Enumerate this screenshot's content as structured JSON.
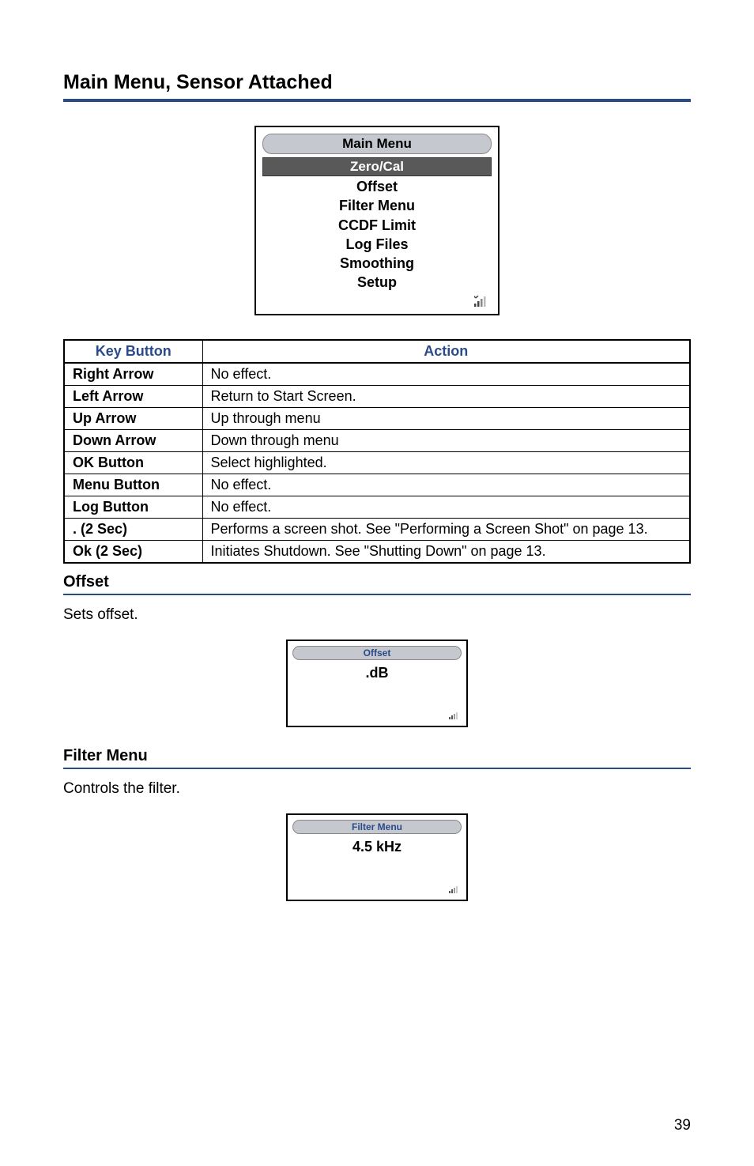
{
  "page": {
    "title": "Main Menu, Sensor Attached",
    "number": "39"
  },
  "main_menu_screenshot": {
    "title": "Main Menu",
    "highlighted": "Zero/Cal",
    "items": [
      "Offset",
      "Filter Menu",
      "CCDF Limit",
      "Log Files",
      "Smoothing",
      "Setup"
    ]
  },
  "table": {
    "headers": {
      "key": "Key Button",
      "action": "Action"
    },
    "rows": [
      {
        "key": "Right Arrow",
        "action": "No effect."
      },
      {
        "key": "Left Arrow",
        "action": "Return to Start Screen."
      },
      {
        "key": "Up Arrow",
        "action": "Up through menu"
      },
      {
        "key": "Down Arrow",
        "action": "Down through menu"
      },
      {
        "key": "OK Button",
        "action": "Select highlighted."
      },
      {
        "key": "Menu Button",
        "action": "No effect."
      },
      {
        "key": "Log Button",
        "action": "No effect."
      },
      {
        "key": ". (2 Sec)",
        "action": "Performs a screen shot. See \"Performing a Screen Shot\" on page 13."
      },
      {
        "key": "Ok (2 Sec)",
        "action": "Initiates Shutdown. See \"Shutting Down\" on page 13."
      }
    ]
  },
  "offset_section": {
    "title": "Offset",
    "body": "Sets offset.",
    "screenshot": {
      "title": "Offset",
      "content": ".dB"
    }
  },
  "filter_section": {
    "title": "Filter Menu",
    "body": "Controls the filter.",
    "screenshot": {
      "title": "Filter Menu",
      "content": "4.5 kHz"
    }
  }
}
